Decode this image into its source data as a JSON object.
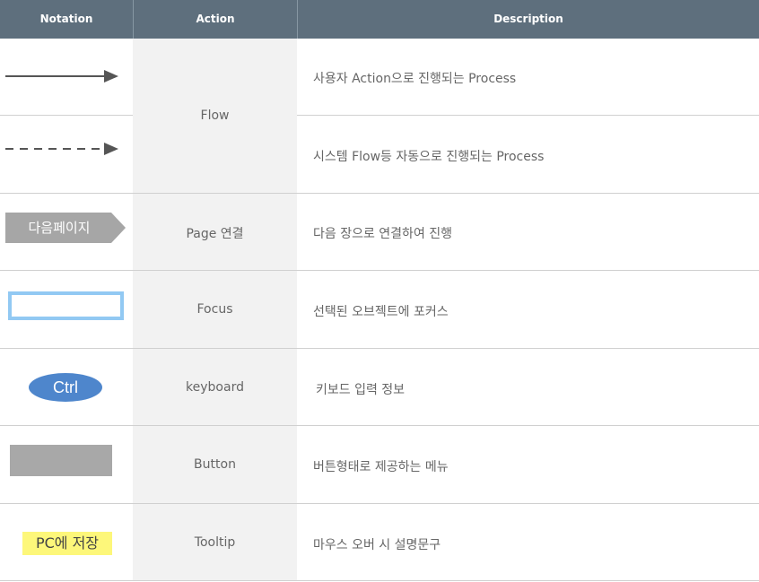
{
  "headers": {
    "notation": "Notation",
    "action": "Action",
    "description": "Description"
  },
  "rows": {
    "flow_action": "Flow",
    "flow_desc_1": "사용자 Action으로 진행되는 Process",
    "flow_desc_2": "시스템 Flow등 자동으로 진행되는 Process",
    "page_label": "다음페이지",
    "page_action": "Page 연결",
    "page_desc": "다음 장으로 연결하여 진행",
    "focus_action": "Focus",
    "focus_desc": "선택된 오브젝트에 포커스",
    "keyboard_label": "Ctrl",
    "keyboard_action": "keyboard",
    "keyboard_desc": "키보드 입력 정보",
    "button_action": "Button",
    "button_desc": "버튼형태로 제공하는 메뉴",
    "tooltip_label": "PC에 저장",
    "tooltip_action": "Tooltip",
    "tooltip_desc": "마우스 오버 시 설명문구"
  },
  "colors": {
    "header_bg": "#5e6f7d",
    "action_col_bg": "#f2f2f2",
    "arrow": "#555555",
    "page_tag": "#a6a6a6",
    "focus_border": "#92c9f3",
    "keyboard": "#4e86cc",
    "button": "#a8a8a8",
    "tooltip": "#fdf77a"
  }
}
